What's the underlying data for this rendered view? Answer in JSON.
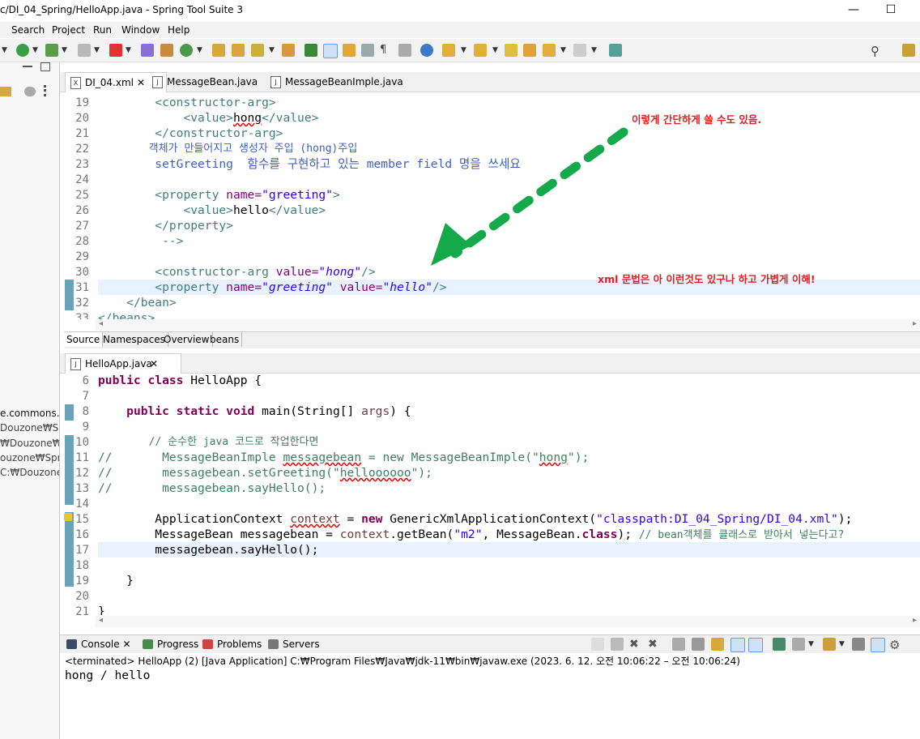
{
  "window": {
    "title": "c/DI_04_Spring/HelloApp.java - Spring Tool Suite 3",
    "minimize": "—",
    "maximize": "☐"
  },
  "menu": [
    "Search",
    "Project",
    "Run",
    "Window",
    "Help"
  ],
  "left_panel": {
    "items": [
      "e.commons.lo",
      "Douzone₩Spri",
      "₩Douzone₩Sp",
      "ouzone₩Sprin",
      "C:₩Douzone₩"
    ]
  },
  "editor_xml": {
    "tabs": [
      "DI_04.xml",
      "MessageBean.java",
      "MessageBeanImple.java"
    ],
    "line_numbers": [
      "19",
      "20",
      "21",
      "22",
      "23",
      "24",
      "25",
      "26",
      "27",
      "28",
      "29",
      "30",
      "31",
      "32",
      "33"
    ],
    "lines": {
      "l19_tag": "<constructor-arg>",
      "l20_open": "<value>",
      "l20_text": "hong",
      "l20_close": "</value>",
      "l21": "</constructor-arg>",
      "l22": "객체가 만들어지고 생성자 주입 (hong)주입",
      "l23": "setGreeting  함수를 구현하고 있는 member field 명을 쓰세요",
      "l25_open": "<property ",
      "l25_attr": "name=",
      "l25_val": "\"greeting\"",
      "l25_close": ">",
      "l26_open": "<value>",
      "l26_text": "hello",
      "l26_close": "</value>",
      "l27": "</property>",
      "l28": " -->",
      "l30_open": "<constructor-arg ",
      "l30_attr": "value=",
      "l30_val": "\"hong\"",
      "l30_close": "/>",
      "l31_open": "<property ",
      "l31_attr1": "name=",
      "l31_val1": "\"greeting\"",
      "l31_attr2": " value=",
      "l31_val2": "\"hello\"",
      "l31_close": "/>",
      "l32": "</bean>",
      "l33": "</beans>"
    },
    "annotation_top": "이렇게 간단하게 쓸 수도 있음.",
    "annotation_bottom": "xml 문법은 아 이런것도 있구나 하고 가볍게 이해!",
    "bottom_tabs": [
      "Source",
      "Namespaces",
      "Overview",
      "beans"
    ]
  },
  "editor_java": {
    "tab": "HelloApp.java",
    "line_numbers": [
      "6",
      "7",
      "8",
      "9",
      "10",
      "11",
      "12",
      "13",
      "14",
      "15",
      "16",
      "17",
      "18",
      "19",
      "20",
      "21"
    ],
    "lines": {
      "l6_kw": "public class ",
      "l6_rest": "HelloApp {",
      "l8_kw": "public static void ",
      "l8_rest": "main(String[] ",
      "l8_args": "args",
      "l8_end": ") {",
      "l10": "// 순수한 java 코드로 작업한다면",
      "l11_a": "//       MessageBeanImple ",
      "l11_b": "messagebean",
      "l11_c": " = new MessageBeanImple(\"",
      "l11_d": "hong",
      "l11_e": "\");",
      "l12_a": "//       messagebean.setGreeting(\"",
      "l12_b": "helloooooo",
      "l12_c": "\");",
      "l13": "//       messagebean.sayHello();",
      "l15_a": "ApplicationContext ",
      "l15_b": "context",
      "l15_c": " = ",
      "l15_d": "new ",
      "l15_e": "GenericXmlApplicationContext(",
      "l15_f": "\"classpath:DI_04_Spring/DI_04.xml\"",
      "l15_g": ");",
      "l16_a": "MessageBean messagebean = ",
      "l16_b": "context",
      "l16_c": ".getBean(",
      "l16_d": "\"m2\"",
      "l16_e": ", MessageBean.",
      "l16_f": "class",
      "l16_g": "); ",
      "l16_h": "// bean객체를 클래스로 받아서 넣는다고?",
      "l17": "messagebean.sayHello();",
      "l19": "}",
      "l21": "}"
    }
  },
  "console": {
    "tabs": [
      "Console",
      "Progress",
      "Problems",
      "Servers"
    ],
    "status": "<terminated> HelloApp (2) [Java Application] C:₩Program Files₩Java₩jdk-11₩bin₩javaw.exe  (2023. 6. 12. 오전 10:06:22 – 오전 10:06:24)",
    "output": "hong / hello"
  },
  "colors": {
    "annotation": "#e02020",
    "arrow": "#14a94a",
    "marker": "#6aa3b8"
  }
}
